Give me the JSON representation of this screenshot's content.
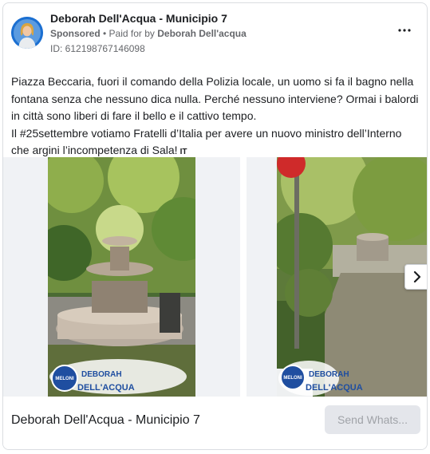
{
  "ad": {
    "page_name": "Deborah Dell'Acqua - Municipio 7",
    "sponsored_label": "Sponsored",
    "separator": " • ",
    "paid_for_prefix": "Paid for by ",
    "payer": "Deborah Dell'acqua",
    "id_label": "ID: 612198767146098",
    "text_lines": [
      "Piazza Beccaria, fuori il comando della Polizia locale, un uomo si fa il bagno nella",
      "fontana senza che nessuno dica nulla. Perché nessuno interviene? Ormai i balordi",
      "in città sono liberi di fare il bello e il cattivo tempo.",
      "Il #25settembre votiamo Fratelli d’Italia per avere un nuovo ministro dell’Interno",
      "che argini l’incompetenza di Sala!"
    ],
    "language_tag": "IT"
  },
  "carousel": {
    "logo_text": "MELONI",
    "overlay_line1": "DEBORAH",
    "overlay_line2": "DELL'ACQUA",
    "next_icon": "chevron-right-icon"
  },
  "footer": {
    "title": "Deborah Dell'Acqua - Municipio 7",
    "cta_label": "Send Whats..."
  },
  "colors": {
    "accent_blue": "#1b6fd1",
    "muted_text": "#65676b",
    "button_bg": "#e4e6eb"
  }
}
